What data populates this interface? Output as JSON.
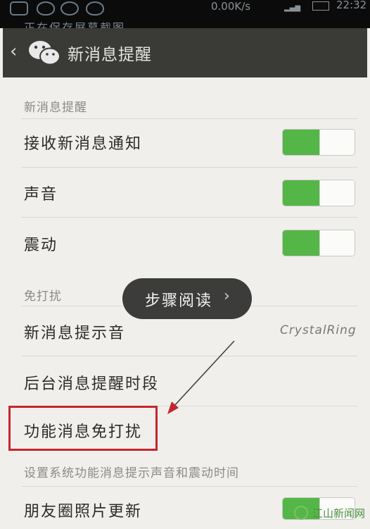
{
  "status_bar": {
    "speed": "0.00K/s",
    "time": "22:32",
    "notification": "正在保存屏幕截图"
  },
  "header": {
    "title": "新消息提醒"
  },
  "sections": {
    "new_message": {
      "label": "新消息提醒",
      "rows": [
        {
          "label": "接收新消息通知",
          "toggle": "on"
        },
        {
          "label": "声音",
          "toggle": "on"
        },
        {
          "label": "震动",
          "toggle": "on"
        }
      ]
    },
    "do_not_disturb": {
      "label": "免打扰",
      "ringtone": {
        "label": "新消息提示音",
        "value": "CrystalRing"
      },
      "background_period": {
        "label": "后台消息提醒时段"
      },
      "feature_dnd": {
        "label": "功能消息免打扰",
        "description": "设置系统功能消息提示声音和震动时间"
      },
      "moments_updates": {
        "label": "朋友圈照片更新",
        "toggle": "on"
      }
    }
  },
  "overlay": {
    "label": "步骤阅读",
    "chevron": "›"
  },
  "watermark": {
    "text": "江山新闻网"
  },
  "colors": {
    "toggle_on": "#54b647",
    "header_bg": "#3a3b37",
    "highlight": "#c3272e"
  }
}
